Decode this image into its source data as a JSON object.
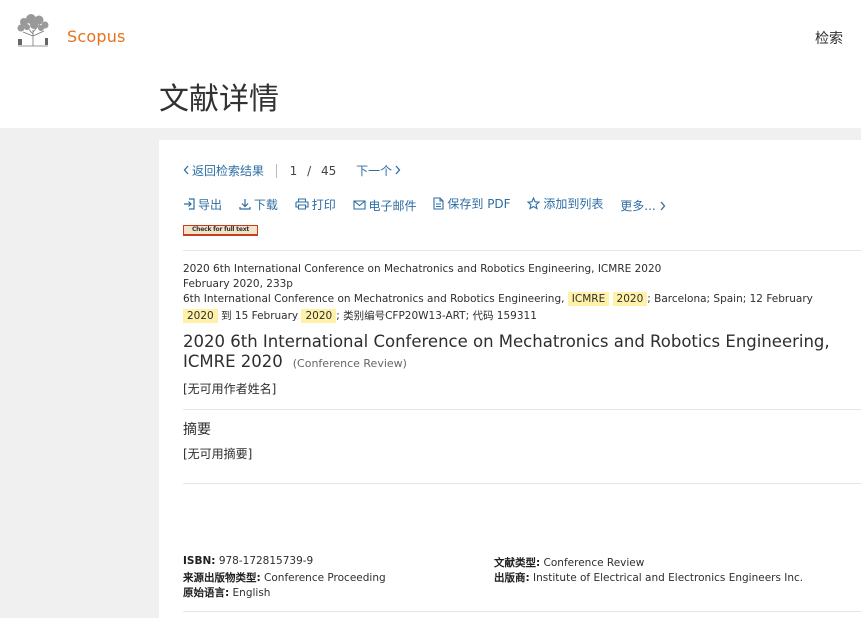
{
  "header": {
    "brand": "Scopus",
    "search_label": "检索",
    "page_title": "文献详情"
  },
  "nav": {
    "back": "返回检索结果",
    "current": "1",
    "slash": "/",
    "total": "45",
    "next": "下一个"
  },
  "toolbar": {
    "export": "导出",
    "download": "下载",
    "print": "打印",
    "email": "电子邮件",
    "save_pdf": "保存到 PDF",
    "add_list": "添加到列表",
    "more": "更多..."
  },
  "check_full_text": "Check for full text",
  "source": {
    "line1": "2020 6th International Conference on Mechatronics and Robotics Engineering, ICMRE 2020",
    "line2": "February 2020, 233p",
    "line3_pre": "6th International Conference on Mechatronics and Robotics Engineering, ",
    "line3_hl1": "ICMRE",
    "line3_hl2": "2020",
    "line3_post": "; Barcelona; Spain; 12 February",
    "line4_hl1": "2020",
    "line4_mid": " 到 15 February ",
    "line4_hl2": "2020",
    "line4_post": "; 类别编号CFP20W13-ART; 代码 159311"
  },
  "document": {
    "title": "2020 6th International Conference on Mechatronics and Robotics Engineering, ICMRE 2020",
    "type": "(Conference Review)",
    "authors": "[无可用作者姓名]"
  },
  "abstract": {
    "heading": "摘要",
    "text": "[无可用摘要]"
  },
  "metadata": {
    "isbn_label": "ISBN:",
    "isbn": "978-172815739-9",
    "src_type_label": "来源出版物类型:",
    "src_type": "Conference Proceeding",
    "lang_label": "原始语言:",
    "lang": "English",
    "doc_type_label": "文献类型:",
    "doc_type": "Conference Review",
    "publisher_label": "出版商:",
    "publisher": "Institute of Electrical and Electronics Engineers Inc."
  }
}
